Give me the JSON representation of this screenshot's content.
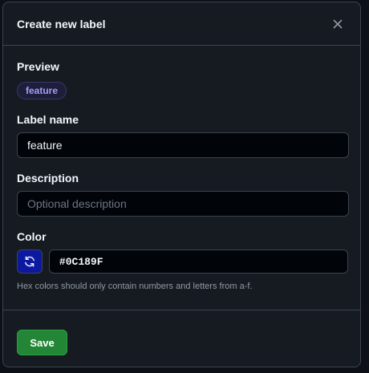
{
  "dialog": {
    "title": "Create new label"
  },
  "preview": {
    "heading": "Preview",
    "badge_text": "feature",
    "badge_color": "#0C189F"
  },
  "label_name": {
    "heading": "Label name",
    "value": "feature"
  },
  "description": {
    "heading": "Description",
    "value": "",
    "placeholder": "Optional description"
  },
  "color": {
    "heading": "Color",
    "value": "#0C189F",
    "hint": "Hex colors should only contain numbers and letters from a-f."
  },
  "footer": {
    "save_label": "Save"
  },
  "colors": {
    "save_button": "#238636",
    "dialog_background": "#161b22",
    "border": "#3d444d"
  },
  "icons": {
    "close": "close-icon",
    "refresh": "sync-icon"
  }
}
